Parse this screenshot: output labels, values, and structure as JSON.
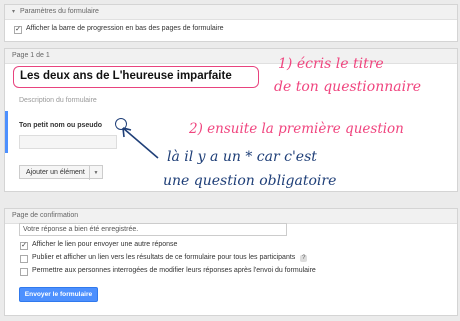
{
  "form_params": {
    "header": "Paramètres du formulaire",
    "progress_checkbox_checked": true,
    "progress_label": "Afficher la barre de progression en bas des pages de formulaire"
  },
  "page_section": {
    "header": "Page 1 de 1",
    "form_title": "Les deux ans de L'heureuse imparfaite",
    "description_placeholder": "Description du formulaire",
    "question_label": "Ton petit nom ou pseudo",
    "required_mark": "*",
    "add_item_label": "Ajouter un élément",
    "add_item_dropdown_icon": "chevron-down-icon"
  },
  "annotations": {
    "title_note_line1": "1) écris le titre",
    "title_note_line2": "de ton questionnaire",
    "question_note": "2) ensuite la première question",
    "required_note_line1": "là il y a un * car c'est",
    "required_note_line2": "une question obligatoire",
    "pink": "#f0457f",
    "navy": "#1f3f78"
  },
  "confirmation": {
    "header": "Page de confirmation",
    "message_value": "Votre réponse a bien été enregistrée.",
    "option1_checked": true,
    "option1_label": "Afficher le lien pour envoyer une autre réponse",
    "option2_checked": false,
    "option2_label": "Publier et afficher un lien vers les résultats de ce formulaire pour tous les participants",
    "option2_help_icon": "?",
    "option3_checked": false,
    "option3_label": "Permettre aux personnes interrogées de modifier leurs réponses après l'envoi du formulaire",
    "submit_label": "Envoyer le formulaire",
    "submit_color": "#4d90fe"
  }
}
